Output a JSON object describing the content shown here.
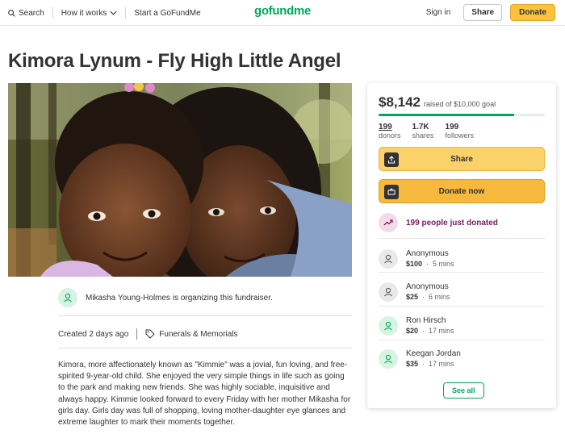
{
  "nav": {
    "search_label": "Search",
    "how_it_works_label": "How it works",
    "start_label": "Start a GoFundMe",
    "logo_text": "gofundme",
    "signin_label": "Sign in",
    "share_label": "Share",
    "donate_label": "Donate"
  },
  "campaign": {
    "title": "Kimora Lynum - Fly High Little Angel",
    "organizer_text": "Mikasha Young-Holmes is organizing this fundraiser.",
    "created_text": "Created 2 days ago",
    "category": "Funerals & Memorials",
    "story": "Kimora, more affectionately known as \"Kimmie\" was a jovial, fun loving, and free-spirited 9-year-old child. She enjoyed the very simple things in life such as going to the park and making new friends.  She was highly sociable, inquisitive and always happy.  Kimmie looked forward to every Friday with her mother Mikasha for girls day.  Girls day was full of shopping, loving mother-daughter eye glances and extreme laughter to mark their moments together."
  },
  "card": {
    "raised_amount": "$8,142",
    "raised_of": "raised of $10,000 goal",
    "progress_fraction": 0.8142,
    "stats": [
      {
        "num": "199",
        "label": "donors"
      },
      {
        "num": "1.7K",
        "label": "shares"
      },
      {
        "num": "199",
        "label": "followers"
      }
    ],
    "share_label": "Share",
    "donate_label": "Donate now",
    "just_donated": "199 people just donated",
    "donations": [
      {
        "name": "Anonymous",
        "amount": "$100",
        "time": "5 mins"
      },
      {
        "name": "Anonymous",
        "amount": "$25",
        "time": "6 mins"
      },
      {
        "name": "Ron Hirsch",
        "amount": "$20",
        "time": "17 mins"
      },
      {
        "name": "Keegan Jordan",
        "amount": "$35",
        "time": "17 mins"
      }
    ],
    "see_all_label": "See all"
  },
  "colors": {
    "brand_green": "#02a95c",
    "donate_yellow": "#f7b83e",
    "trend_purple": "#7a1d5d"
  }
}
